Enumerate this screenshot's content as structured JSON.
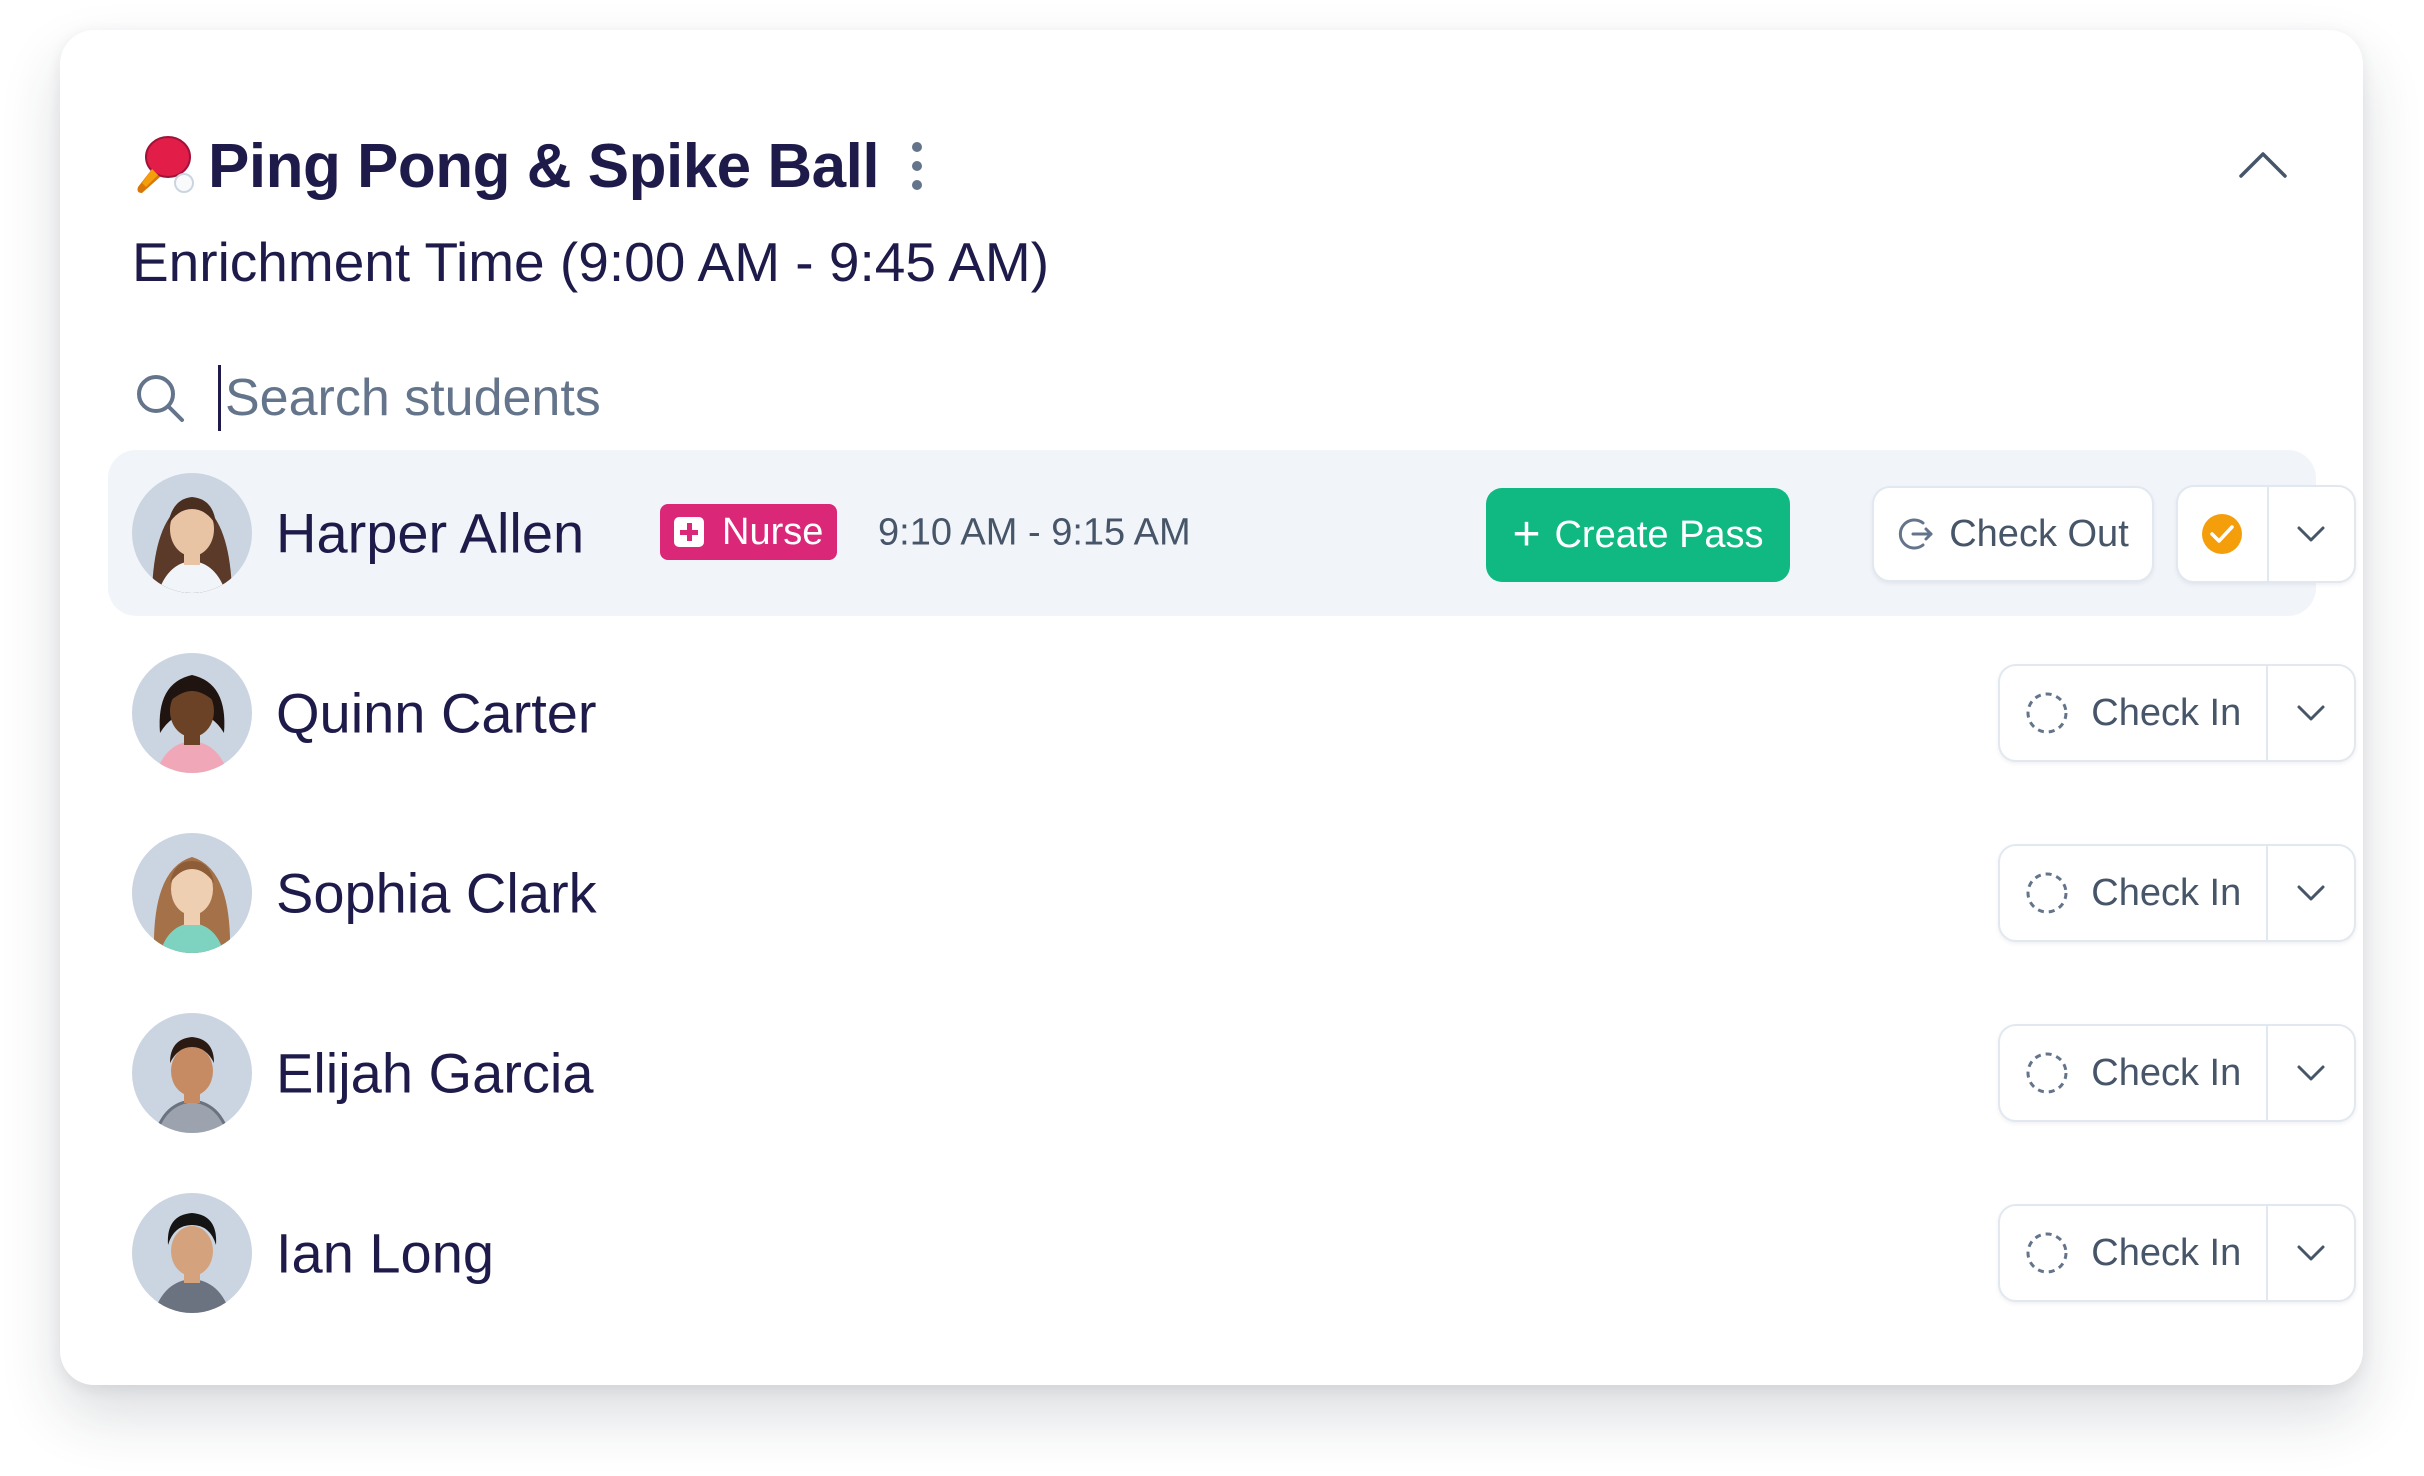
{
  "activity": {
    "icon": "ping-pong-paddle-icon",
    "title": "Ping Pong & Spike Ball",
    "subtitle": "Enrichment Time (9:00 AM - 9:45 AM)"
  },
  "search": {
    "placeholder": "Search students",
    "value": ""
  },
  "colors": {
    "accent_green": "#10b981",
    "nurse_pink": "#db2777",
    "status_orange": "#f59e0b",
    "text_dark": "#1e1b4b"
  },
  "students": [
    {
      "name": "Harper Allen",
      "pass_badge": "Nurse",
      "pass_time": "9:10 AM - 9:15 AM",
      "create_pass_label": "Create Pass",
      "check_out_label": "Check Out",
      "status": "checked-in"
    },
    {
      "name": "Quinn Carter",
      "action_label": "Check In"
    },
    {
      "name": "Sophia Clark",
      "action_label": "Check In"
    },
    {
      "name": "Elijah Garcia",
      "action_label": "Check In"
    },
    {
      "name": "Ian Long",
      "action_label": "Check In"
    }
  ]
}
